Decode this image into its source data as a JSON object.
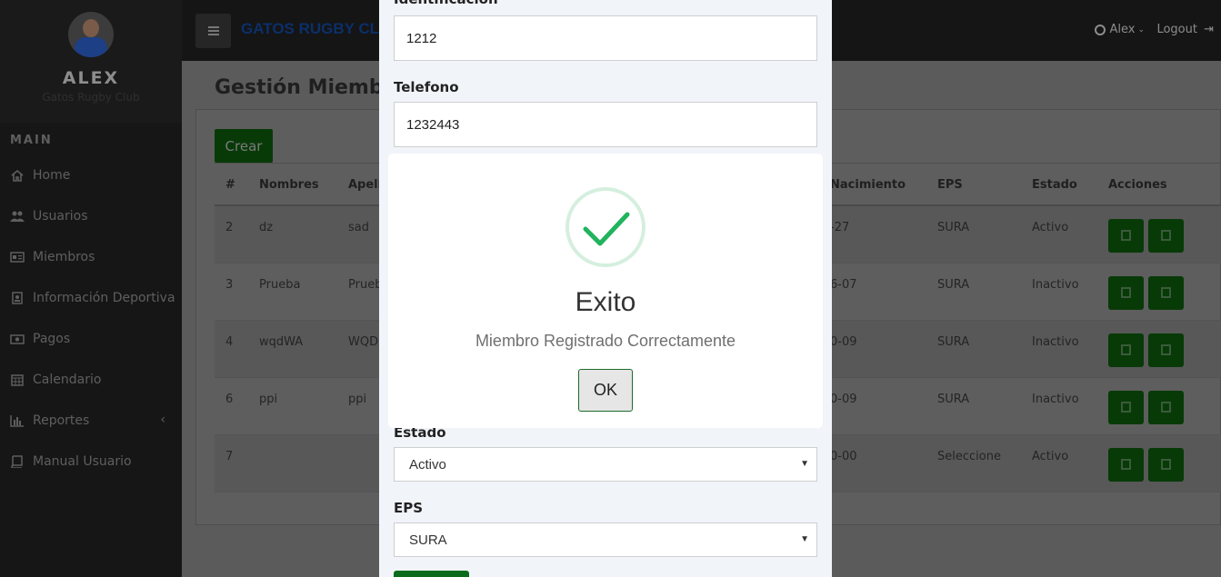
{
  "profile": {
    "name": "ALEX",
    "club": "Gatos Rugby Club"
  },
  "sidebar": {
    "section_title": "MAIN",
    "items": [
      {
        "label": "Home",
        "icon": "home-icon"
      },
      {
        "label": "Usuarios",
        "icon": "users-icon"
      },
      {
        "label": "Miembros",
        "icon": "id-card-icon"
      },
      {
        "label": "Información Deportiva",
        "icon": "badge-icon"
      },
      {
        "label": "Pagos",
        "icon": "money-icon"
      },
      {
        "label": "Calendario",
        "icon": "calendar-icon"
      },
      {
        "label": "Reportes",
        "icon": "bar-chart-icon",
        "has_submenu": true
      },
      {
        "label": "Manual Usuario",
        "icon": "book-icon"
      }
    ]
  },
  "topbar": {
    "brand": "GATOS RUGBY CL",
    "user": "Alex",
    "logout": "Logout"
  },
  "page": {
    "title": "Gestión Miembro",
    "create_button": "Crear"
  },
  "table": {
    "headers": {
      "num": "#",
      "nombres": "Nombres",
      "apellidos": "Apell",
      "nacimiento": "Nacimiento",
      "eps": "EPS",
      "estado": "Estado",
      "acciones": "Acciones"
    },
    "rows": [
      {
        "num": "2",
        "nombres": "dz",
        "apellidos": "sad",
        "nacimiento": "-27",
        "eps": "SURA",
        "estado": "Activo"
      },
      {
        "num": "3",
        "nombres": "Prueba",
        "apellidos": "Prueb",
        "nacimiento": "6-07",
        "eps": "SURA",
        "estado": "Inactivo"
      },
      {
        "num": "4",
        "nombres": "wqdWA",
        "apellidos": "WQD",
        "nacimiento": "0-09",
        "eps": "SURA",
        "estado": "Inactivo"
      },
      {
        "num": "6",
        "nombres": "ppi",
        "apellidos": "ppi",
        "nacimiento": "0-09",
        "eps": "SURA",
        "estado": "Inactivo"
      },
      {
        "num": "7",
        "nombres": "",
        "apellidos": "",
        "nacimiento": "0-00",
        "eps": "Seleccione",
        "estado": "Activo"
      }
    ]
  },
  "form": {
    "identificacion_label": "Identificacion",
    "identificacion_value": "1212",
    "telefono_label": "Telefono",
    "telefono_value": "1232443",
    "estado_label": "Estado",
    "estado_value": "Activo",
    "eps_label": "EPS",
    "eps_value": "SURA"
  },
  "alert": {
    "title": "Exito",
    "message": "Miembro Registrado Correctamente",
    "ok_label": "OK",
    "success_color": "#22b35e"
  }
}
